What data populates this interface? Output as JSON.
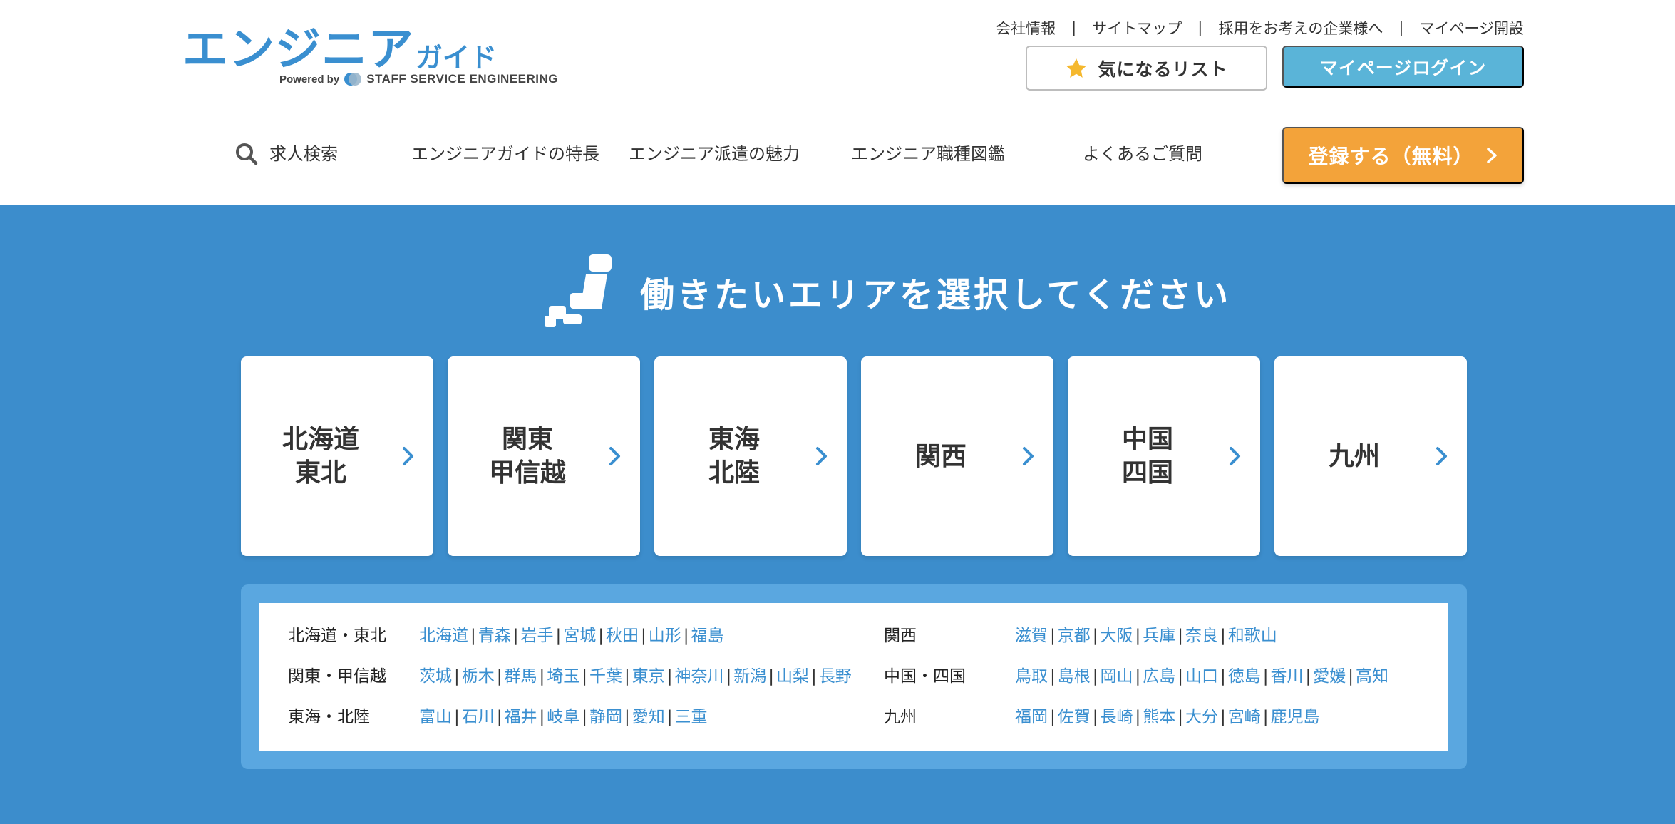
{
  "header": {
    "logo": {
      "main_text": "エンジニア",
      "sub_text": "ガイド",
      "powered_by": "Powered by",
      "brand": "STAFF SERVICE ENGINEERING"
    },
    "util_links": [
      {
        "label": "会社情報"
      },
      {
        "label": "サイトマップ"
      },
      {
        "label": "採用をお考えの企業様へ"
      },
      {
        "label": "マイページ開設"
      }
    ],
    "separator": "|",
    "favorite_button": "気になるリスト",
    "login_button": "マイページログイン"
  },
  "nav": {
    "items": [
      {
        "label": "求人検索"
      },
      {
        "label": "エンジニアガイドの特長"
      },
      {
        "label": "エンジニア派遣の魅力"
      },
      {
        "label": "エンジニア職種図鑑"
      },
      {
        "label": "よくあるご質問"
      }
    ],
    "register_button": "登録する（無料）"
  },
  "area": {
    "heading": "働きたいエリアを選択してください",
    "regions": [
      {
        "label": "北海道\n東北"
      },
      {
        "label": "関東\n甲信越"
      },
      {
        "label": "東海\n北陸"
      },
      {
        "label": "関西"
      },
      {
        "label": "中国\n四国"
      },
      {
        "label": "九州"
      }
    ],
    "pref_groups": [
      {
        "region": "北海道・東北",
        "prefs": [
          "北海道",
          "青森",
          "岩手",
          "宮城",
          "秋田",
          "山形",
          "福島"
        ]
      },
      {
        "region": "関東・甲信越",
        "prefs": [
          "茨城",
          "栃木",
          "群馬",
          "埼玉",
          "千葉",
          "東京",
          "神奈川",
          "新潟",
          "山梨",
          "長野"
        ]
      },
      {
        "region": "東海・北陸",
        "prefs": [
          "富山",
          "石川",
          "福井",
          "岐阜",
          "静岡",
          "愛知",
          "三重"
        ]
      },
      {
        "region": "関西",
        "prefs": [
          "滋賀",
          "京都",
          "大阪",
          "兵庫",
          "奈良",
          "和歌山"
        ]
      },
      {
        "region": "中国・四国",
        "prefs": [
          "鳥取",
          "島根",
          "岡山",
          "広島",
          "山口",
          "徳島",
          "香川",
          "愛媛",
          "高知"
        ]
      },
      {
        "region": "九州",
        "prefs": [
          "福岡",
          "佐賀",
          "長崎",
          "熊本",
          "大分",
          "宮崎",
          "鹿児島"
        ]
      }
    ]
  },
  "colors": {
    "brand_blue": "#3a8fd0",
    "section_blue": "#3c8dcc",
    "login_blue": "#5ab4d8",
    "register_orange": "#f3a33a",
    "star_yellow": "#f5b82e"
  },
  "icons": {
    "search": "search-icon",
    "favorite": "star-icon",
    "region_arrow": "chevron-right-icon",
    "area_map": "japan-map-icon"
  }
}
